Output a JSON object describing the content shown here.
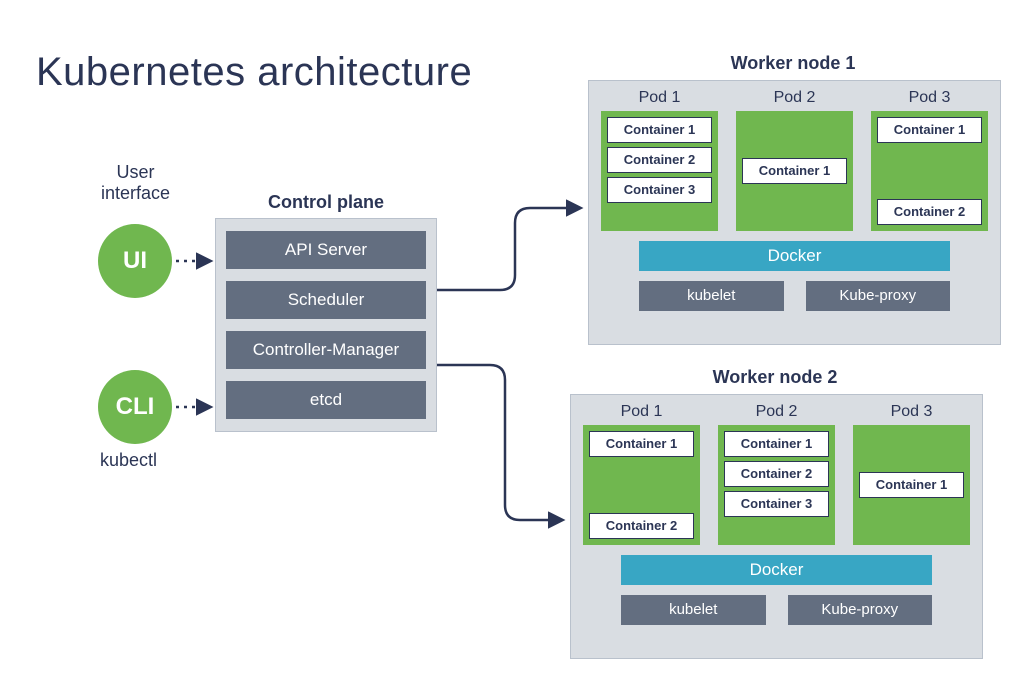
{
  "title": "Kubernetes architecture",
  "user_interface": {
    "heading": "User\ninterface",
    "ui_label": "UI",
    "cli_label": "CLI",
    "kubectl": "kubectl"
  },
  "control_plane": {
    "heading": "Control plane",
    "components": [
      "API Server",
      "Scheduler",
      "Controller-Manager",
      "etcd"
    ]
  },
  "workers": [
    {
      "title": "Worker node 1",
      "pods": [
        {
          "label": "Pod 1",
          "containers": [
            "Container 1",
            "Container 2",
            "Container 3"
          ],
          "layout": "top"
        },
        {
          "label": "Pod 2",
          "containers": [
            "Container 1"
          ],
          "layout": "middle"
        },
        {
          "label": "Pod 3",
          "containers": [
            "Container 1",
            "Container 2"
          ],
          "layout": "split"
        }
      ],
      "docker": "Docker",
      "bottom": [
        "kubelet",
        "Kube-proxy"
      ]
    },
    {
      "title": "Worker node 2",
      "pods": [
        {
          "label": "Pod 1",
          "containers": [
            "Container 1",
            "Container 2"
          ],
          "layout": "split"
        },
        {
          "label": "Pod 2",
          "containers": [
            "Container 1",
            "Container 2",
            "Container 3"
          ],
          "layout": "top"
        },
        {
          "label": "Pod 3",
          "containers": [
            "Container 1"
          ],
          "layout": "middle"
        }
      ],
      "docker": "Docker",
      "bottom": [
        "kubelet",
        "Kube-proxy"
      ]
    }
  ]
}
